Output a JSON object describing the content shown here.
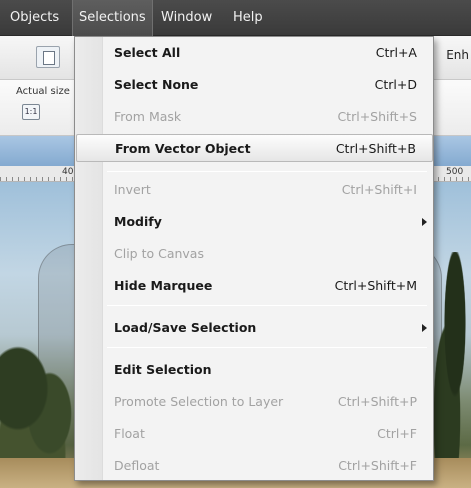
{
  "menubar": {
    "items": [
      {
        "label": "Objects"
      },
      {
        "label": "Selections"
      },
      {
        "label": "Window"
      },
      {
        "label": "Help"
      }
    ]
  },
  "toolbar": {
    "partial_label": "Enh",
    "actual_size_label": "Actual size",
    "actual_size_button": "1:1"
  },
  "ruler": {
    "labels": [
      "40",
      "500"
    ]
  },
  "dropdown": {
    "items": [
      {
        "label": "Select All",
        "shortcut": "Ctrl+A",
        "enabled": true
      },
      {
        "label": "Select None",
        "shortcut": "Ctrl+D",
        "enabled": true
      },
      {
        "label": "From Mask",
        "shortcut": "Ctrl+Shift+S",
        "enabled": false
      },
      {
        "label": "From Vector Object",
        "shortcut": "Ctrl+Shift+B",
        "enabled": true,
        "highlighted": true
      },
      {
        "label": "Invert",
        "shortcut": "Ctrl+Shift+I",
        "enabled": false
      },
      {
        "label": "Modify",
        "shortcut": "",
        "enabled": true,
        "submenu": true
      },
      {
        "label": "Clip to Canvas",
        "shortcut": "",
        "enabled": false
      },
      {
        "label": "Hide Marquee",
        "shortcut": "Ctrl+Shift+M",
        "enabled": true
      },
      {
        "label": "Load/Save Selection",
        "shortcut": "",
        "enabled": true,
        "submenu": true
      },
      {
        "label": "Edit Selection",
        "shortcut": "",
        "enabled": true
      },
      {
        "label": "Promote Selection to Layer",
        "shortcut": "Ctrl+Shift+P",
        "enabled": false
      },
      {
        "label": "Float",
        "shortcut": "Ctrl+F",
        "enabled": false
      },
      {
        "label": "Defloat",
        "shortcut": "Ctrl+Shift+F",
        "enabled": false
      }
    ]
  },
  "colors": {
    "menubar_bg": "#444444",
    "menu_bg": "#f3f3f3",
    "disabled_text": "#a2a2a2"
  }
}
